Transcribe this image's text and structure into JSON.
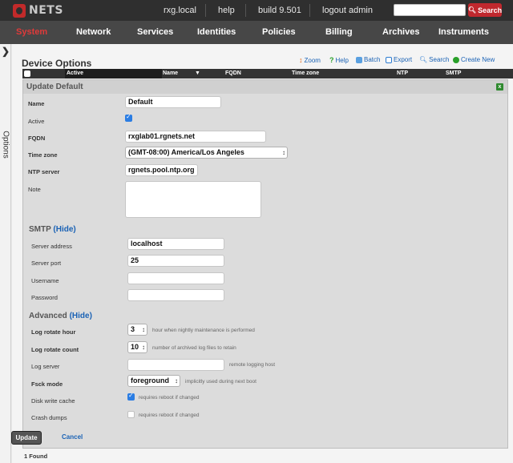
{
  "brand": {
    "logo_text": "NETS",
    "accent": "#c22a2a"
  },
  "topbar": {
    "links": [
      "rxg.local",
      "help",
      "build 9.501",
      "logout admin"
    ],
    "search_button": "Search",
    "search_placeholder": ""
  },
  "nav": {
    "items": [
      "System",
      "Network",
      "Services",
      "Identities",
      "Policies",
      "Billing",
      "Archives",
      "Instruments"
    ],
    "active": "System"
  },
  "sidebar": {
    "options_label": "Options"
  },
  "page": {
    "title": "Device Options",
    "actions": [
      {
        "label": "Zoom",
        "icon": "zoom-icon",
        "color": "#e06a1a"
      },
      {
        "label": "Help",
        "icon": "help-icon",
        "color": "#2aa02a"
      },
      {
        "label": "Batch",
        "icon": "batch-icon",
        "color": "#2a7ad0"
      },
      {
        "label": "Export",
        "icon": "export-icon",
        "color": "#2a7ad0"
      },
      {
        "label": "Search",
        "icon": "search-icon",
        "color": "#2a7ad0"
      },
      {
        "label": "Create New",
        "icon": "create-new-icon",
        "color": "#2aa02a"
      }
    ],
    "columns": [
      "Active",
      "Name",
      "FQDN",
      "Time zone",
      "NTP",
      "SMTP"
    ],
    "found": "1 Found"
  },
  "form": {
    "title": "Update Default",
    "name_label": "Name",
    "name_value": "Default",
    "active_label": "Active",
    "active_checked": true,
    "fqdn_label": "FQDN",
    "fqdn_value": "rxglab01.rgnets.net",
    "timezone_label": "Time zone",
    "timezone_value": "(GMT-08:00) America/Los Angeles",
    "ntp_label": "NTP server",
    "ntp_value": "rgnets.pool.ntp.org",
    "note_label": "Note",
    "note_value": "",
    "smtp": {
      "title": "SMTP",
      "hide": "(Hide)",
      "server_address_label": "Server address",
      "server_address_value": "localhost",
      "server_port_label": "Server port",
      "server_port_value": "25",
      "username_label": "Username",
      "username_value": "",
      "password_label": "Password",
      "password_value": ""
    },
    "advanced": {
      "title": "Advanced",
      "hide": "(Hide)",
      "log_rotate_hour_label": "Log rotate hour",
      "log_rotate_hour_value": "3",
      "log_rotate_hour_hint": "hour when nightly maintenance is performed",
      "log_rotate_count_label": "Log rotate count",
      "log_rotate_count_value": "10",
      "log_rotate_count_hint": "number of archived log files to retain",
      "log_server_label": "Log server",
      "log_server_value": "",
      "log_server_hint": "remote logging host",
      "fsck_mode_label": "Fsck mode",
      "fsck_mode_value": "foreground",
      "fsck_mode_hint": "implicitly used during next boot",
      "disk_write_cache_label": "Disk write cache",
      "disk_write_cache_checked": true,
      "disk_write_cache_hint": "requires reboot if changed",
      "crash_dumps_label": "Crash dumps",
      "crash_dumps_checked": false,
      "crash_dumps_hint": "requires reboot if changed"
    },
    "update_button": "Update",
    "cancel_link": "Cancel"
  }
}
